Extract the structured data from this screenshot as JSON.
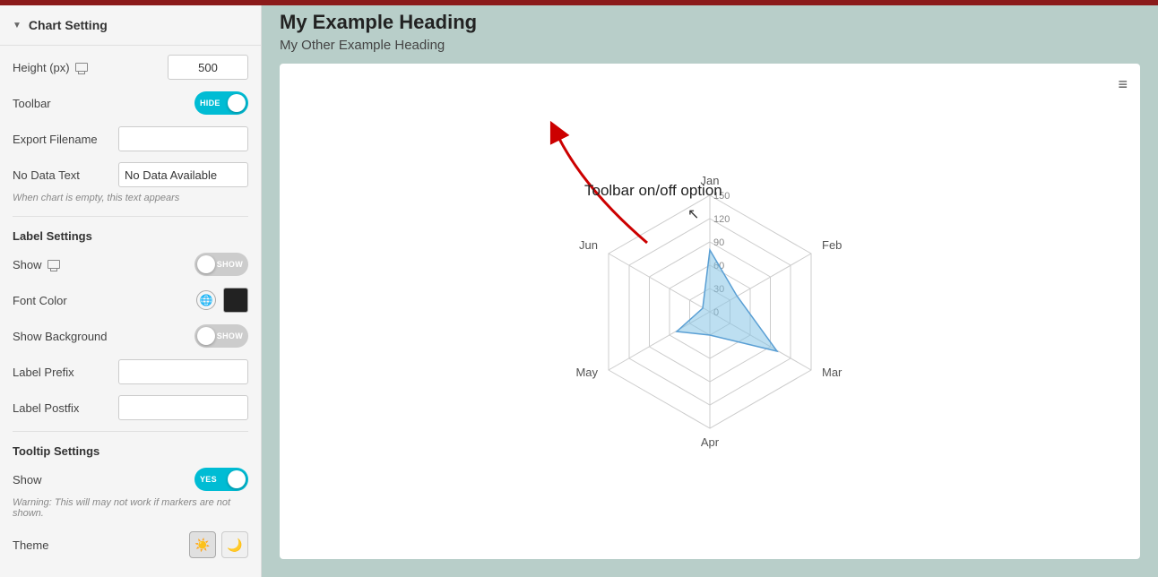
{
  "topBar": {
    "color": "#8b1a1a"
  },
  "leftPanel": {
    "sectionTitle": "Chart Setting",
    "chevron": "▼",
    "settings": {
      "heightLabel": "Height (px)",
      "heightValue": "500",
      "toolbarLabel": "Toolbar",
      "toolbarState": "hide",
      "toolbarToggleLabel": "HIDE",
      "exportFilenameLabel": "Export Filename",
      "exportFilenameValue": "",
      "noDataTextLabel": "No Data Text",
      "noDataTextValue": "No Data Available",
      "noDataHint": "When chart is empty, this text appears"
    },
    "labelSettings": {
      "title": "Label Settings",
      "showLabel": "Show",
      "showState": "show",
      "showToggleLabel": "SHOW",
      "fontColorLabel": "Font Color",
      "fontColor": "#222222",
      "showBackgroundLabel": "Show Background",
      "showBackgroundState": "show",
      "showBackgroundToggleLabel": "SHOW",
      "labelPrefixLabel": "Label Prefix",
      "labelPrefixValue": "",
      "labelPostfixLabel": "Label Postfix",
      "labelPostfixValue": ""
    },
    "tooltipSettings": {
      "title": "Tooltip Settings",
      "showLabel": "Show",
      "showState": "yes",
      "showToggleLabel": "YES",
      "warningText": "Warning: This will may not work if markers are not shown.",
      "themeLabel": "Theme",
      "themeSun": "☀",
      "themeMoon": "🌙"
    }
  },
  "rightPanel": {
    "heading": "My Example Heading",
    "subheading": "My Other Example Heading",
    "menuIcon": "≡",
    "annotation": {
      "text": "Toolbar\non/off option"
    },
    "chart": {
      "labels": [
        "Jan",
        "Feb",
        "Mar",
        "Apr",
        "May",
        "Jun"
      ],
      "rings": [
        0,
        30,
        60,
        90,
        120,
        150
      ],
      "ringValues": [
        "0",
        "30",
        "60",
        "90",
        "120",
        "150"
      ],
      "color": "#a8c8e8",
      "strokeColor": "#5a9fd4"
    }
  }
}
